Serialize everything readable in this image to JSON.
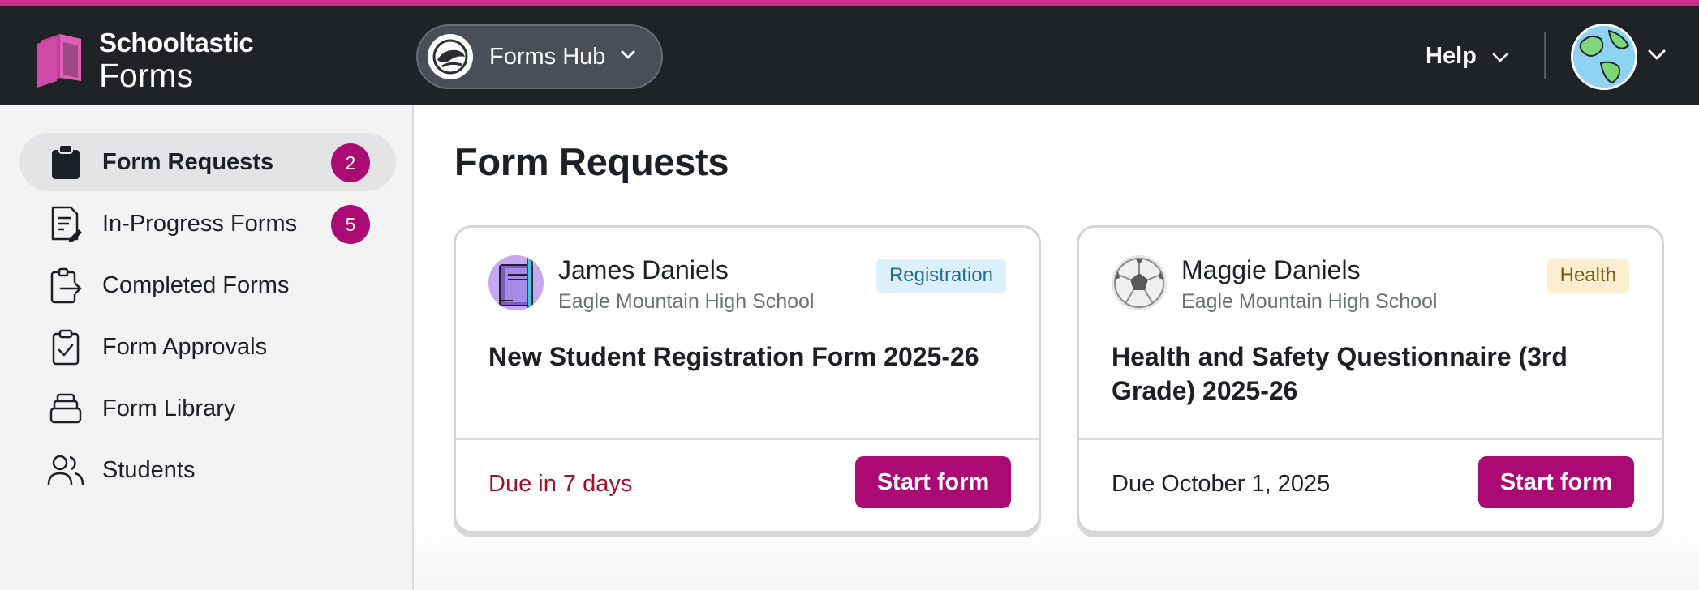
{
  "app": {
    "brand_line1": "Schooltastic",
    "brand_line2": "Forms",
    "accent_color": "#ab0a75",
    "stripe_color": "#c72e8a"
  },
  "header": {
    "hub_label": "Forms Hub",
    "help_label": "Help"
  },
  "sidebar": {
    "items": [
      {
        "label": "Form Requests",
        "icon": "clipboard-icon",
        "badge": "2",
        "active": true
      },
      {
        "label": "In-Progress Forms",
        "icon": "document-edit-icon",
        "badge": "5"
      },
      {
        "label": "Completed Forms",
        "icon": "clipboard-export-icon"
      },
      {
        "label": "Form Approvals",
        "icon": "clipboard-check-icon"
      },
      {
        "label": "Form Library",
        "icon": "stack-icon"
      },
      {
        "label": "Students",
        "icon": "people-icon"
      }
    ]
  },
  "main": {
    "title": "Form Requests",
    "cards": [
      {
        "student": "James Daniels",
        "school": "Eagle Mountain High School",
        "tag": "Registration",
        "form_title": "New Student Registration Form 2025-26",
        "due": "Due in 7 days",
        "button": "Start form"
      },
      {
        "student": "Maggie Daniels",
        "school": "Eagle Mountain High School",
        "tag": "Health",
        "form_title": "Health and Safety Questionnaire (3rd Grade) 2025-26",
        "due": "Due October 1, 2025",
        "button": "Start form"
      }
    ]
  }
}
